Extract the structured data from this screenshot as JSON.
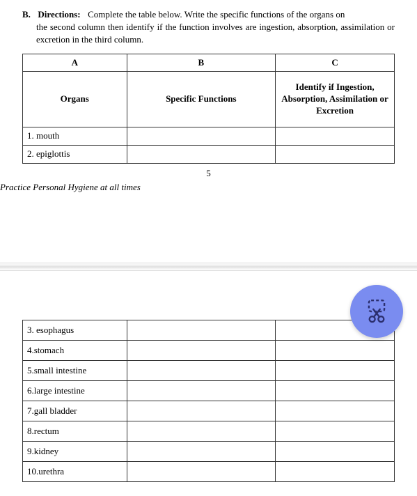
{
  "section_label": "B.",
  "directions_label": "Directions:",
  "directions_text_line1": "Complete the table below. Write the specific functions of the organs on",
  "directions_text_line2": "the second column then identify if the function involves are ingestion, absorption, assimilation or excretion in the third column.",
  "columns": {
    "a": {
      "letter": "A",
      "header": "Organs"
    },
    "b": {
      "letter": "B",
      "header": "Specific Functions"
    },
    "c": {
      "letter": "C",
      "header": "Identify if Ingestion, Absorption, Assimilation or Excretion"
    }
  },
  "rows_top": [
    {
      "organ": "1. mouth",
      "func": "",
      "type": ""
    },
    {
      "organ": "2. epiglottis",
      "func": "",
      "type": ""
    }
  ],
  "rows_bottom": [
    {
      "organ": "3. esophagus",
      "func": "",
      "type": ""
    },
    {
      "organ": "4.stomach",
      "func": "",
      "type": ""
    },
    {
      "organ": "5.small intestine",
      "func": "",
      "type": ""
    },
    {
      "organ": "6.large intestine",
      "func": "",
      "type": ""
    },
    {
      "organ": "7.gall bladder",
      "func": "",
      "type": ""
    },
    {
      "organ": "8.rectum",
      "func": "",
      "type": ""
    },
    {
      "organ": "9.kidney",
      "func": "",
      "type": ""
    },
    {
      "organ": "10.urethra",
      "func": "",
      "type": ""
    }
  ],
  "page_number": "5",
  "footer_note": "Practice Personal Hygiene at all times"
}
